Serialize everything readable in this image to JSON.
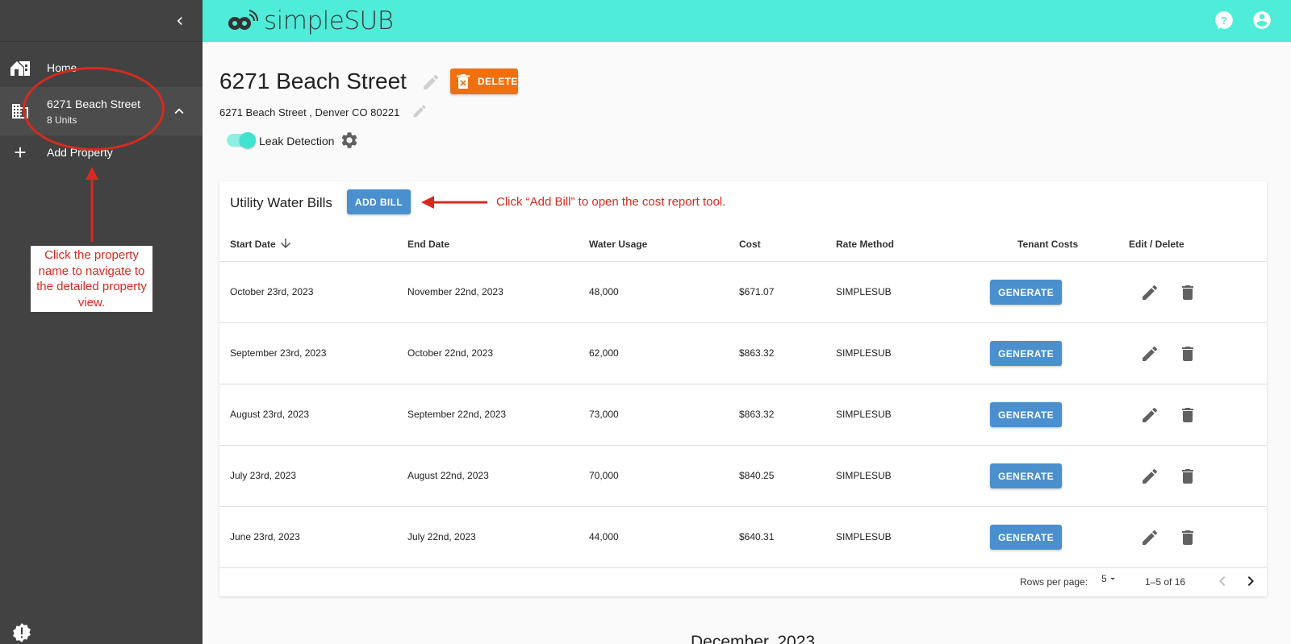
{
  "app": {
    "logo_text": "simpleSUB",
    "accent_color": "#4eecd9",
    "sidebar_color": "#424242"
  },
  "sidebar": {
    "items": [
      {
        "label": "Home",
        "icon": "home-icon"
      },
      {
        "label": "6271 Beach Street",
        "sublabel": "8 Units",
        "icon": "building-icon"
      },
      {
        "label": "Add Property",
        "icon": "plus-icon"
      }
    ]
  },
  "annotations": {
    "callout_text": "Click the property name to navigate to the detailed property view.",
    "bill_hint": "Click “Add Bill” to open the cost report tool.",
    "color": "#d72a1f"
  },
  "property": {
    "title": "6271 Beach Street",
    "delete_label": "DELETE",
    "address": "6271 Beach Street , Denver CO 80221",
    "leak_detection_label": "Leak Detection",
    "leak_detection_on": true
  },
  "bills": {
    "title": "Utility Water Bills",
    "add_label": "ADD BILL",
    "columns": [
      "Start Date",
      "End Date",
      "Water Usage",
      "Cost",
      "Rate Method",
      "Tenant Costs",
      "Edit / Delete"
    ],
    "generate_label": "GENERATE",
    "rows": [
      {
        "start": "October 23rd, 2023",
        "end": "November 22nd, 2023",
        "usage": "48,000",
        "cost": "$671.07",
        "method": "SIMPLESUB"
      },
      {
        "start": "September 23rd, 2023",
        "end": "October 22nd, 2023",
        "usage": "62,000",
        "cost": "$863.32",
        "method": "SIMPLESUB"
      },
      {
        "start": "August 23rd, 2023",
        "end": "September 22nd, 2023",
        "usage": "73,000",
        "cost": "$863.32",
        "method": "SIMPLESUB"
      },
      {
        "start": "July 23rd, 2023",
        "end": "August 22nd, 2023",
        "usage": "70,000",
        "cost": "$840.25",
        "method": "SIMPLESUB"
      },
      {
        "start": "June 23rd, 2023",
        "end": "July 22nd, 2023",
        "usage": "44,000",
        "cost": "$640.31",
        "method": "SIMPLESUB"
      }
    ],
    "pager": {
      "rows_label": "Rows per page:",
      "rows_value": "5",
      "range": "1–5 of 16"
    }
  },
  "next_section": {
    "heading": "December, 2023"
  }
}
